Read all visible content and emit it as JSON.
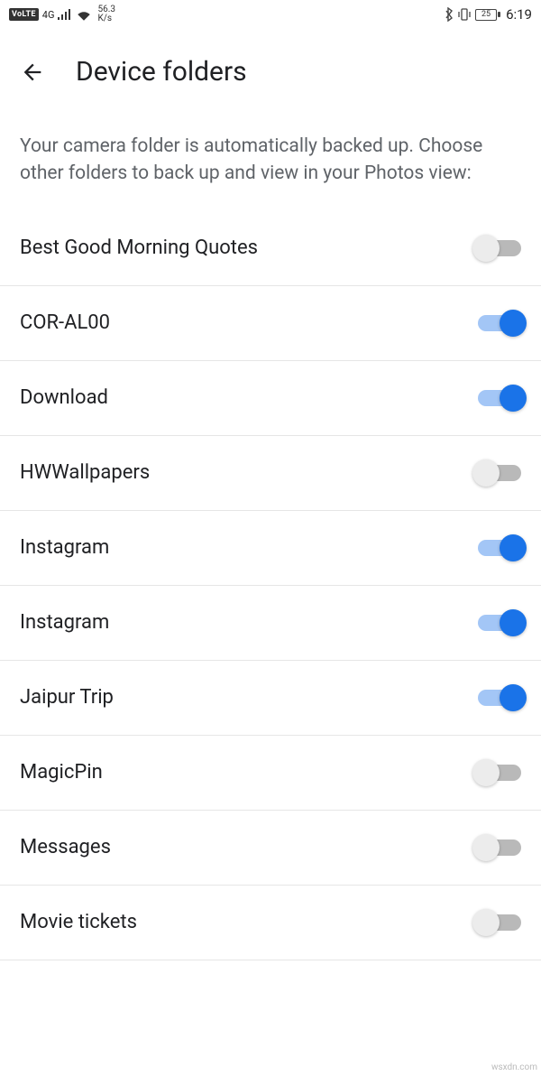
{
  "status_bar": {
    "volte": "VoLTE",
    "net": "4G",
    "speed_top": "56.3",
    "speed_bottom": "K/s",
    "battery_pct": "25",
    "clock": "6:19"
  },
  "header": {
    "title": "Device folders"
  },
  "description": "Your camera folder is automatically backed up. Choose other folders to back up and view in your Photos view:",
  "folders": [
    {
      "name": "Best Good Morning Quotes",
      "enabled": false
    },
    {
      "name": "COR-AL00",
      "enabled": true
    },
    {
      "name": "Download",
      "enabled": true
    },
    {
      "name": "HWWallpapers",
      "enabled": false
    },
    {
      "name": "Instagram",
      "enabled": true
    },
    {
      "name": "Instagram",
      "enabled": true
    },
    {
      "name": "Jaipur Trip",
      "enabled": true
    },
    {
      "name": "MagicPin",
      "enabled": false
    },
    {
      "name": "Messages",
      "enabled": false
    },
    {
      "name": "Movie tickets",
      "enabled": false
    }
  ],
  "watermark": "wsxdn.com"
}
